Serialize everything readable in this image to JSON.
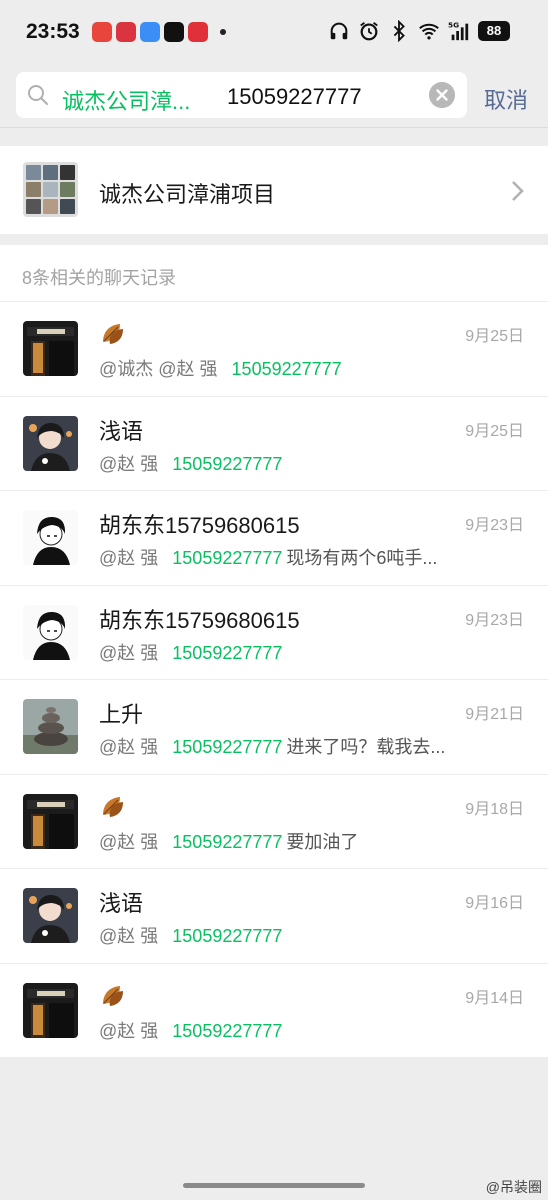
{
  "status_bar": {
    "time": "23:53",
    "battery": "88",
    "network": "5G",
    "app_icons": [
      "video-app-icon",
      "news-app-icon",
      "cloud-app-icon",
      "tiktok-icon",
      "music-app-icon"
    ],
    "right_icons": [
      "headphones-icon",
      "alarm-icon",
      "bluetooth-icon",
      "wifi-icon",
      "signal-icon"
    ]
  },
  "search": {
    "tag": "诚杰公司漳...",
    "query": "15059227777",
    "cancel_label": "取消"
  },
  "group": {
    "name": "诚杰公司漳浦项目"
  },
  "records": {
    "header": "8条相关的聊天记录",
    "items": [
      {
        "name": "",
        "name_icon": "leaf-icon",
        "date": "9月25日",
        "at": "@诚杰 @赵  强",
        "highlight": "15059227777",
        "rest": "",
        "avatar": "shop-avatar"
      },
      {
        "name": "浅语",
        "name_icon": "",
        "date": "9月25日",
        "at": "@赵  强",
        "highlight": "15059227777",
        "rest": "",
        "avatar": "anime-boy-color-avatar"
      },
      {
        "name": "胡东东15759680615",
        "name_icon": "",
        "date": "9月23日",
        "at": "@赵  强",
        "highlight": "15059227777",
        "rest": "现场有两个6吨手...",
        "avatar": "anime-boy-bw-avatar"
      },
      {
        "name": "胡东东15759680615",
        "name_icon": "",
        "date": "9月23日",
        "at": "@赵  强",
        "highlight": "15059227777",
        "rest": "",
        "avatar": "anime-boy-bw-avatar"
      },
      {
        "name": "上升",
        "name_icon": "",
        "date": "9月21日",
        "at": "@赵  强",
        "highlight": "15059227777",
        "rest": "进来了吗？载我去...",
        "avatar": "stones-avatar"
      },
      {
        "name": "",
        "name_icon": "leaf-icon",
        "date": "9月18日",
        "at": "@赵  强",
        "highlight": "15059227777",
        "rest": "要加油了",
        "avatar": "shop-avatar"
      },
      {
        "name": "浅语",
        "name_icon": "",
        "date": "9月16日",
        "at": "@赵  强",
        "highlight": "15059227777",
        "rest": "",
        "avatar": "anime-boy-color-avatar"
      },
      {
        "name": "",
        "name_icon": "leaf-icon",
        "date": "9月14日",
        "at": "@赵  强",
        "highlight": "15059227777",
        "rest": "",
        "avatar": "shop-avatar"
      }
    ]
  },
  "watermark": "@吊装圈",
  "colors": {
    "accent_green": "#07c160",
    "link_blue": "#576b95",
    "background": "#ededed"
  }
}
